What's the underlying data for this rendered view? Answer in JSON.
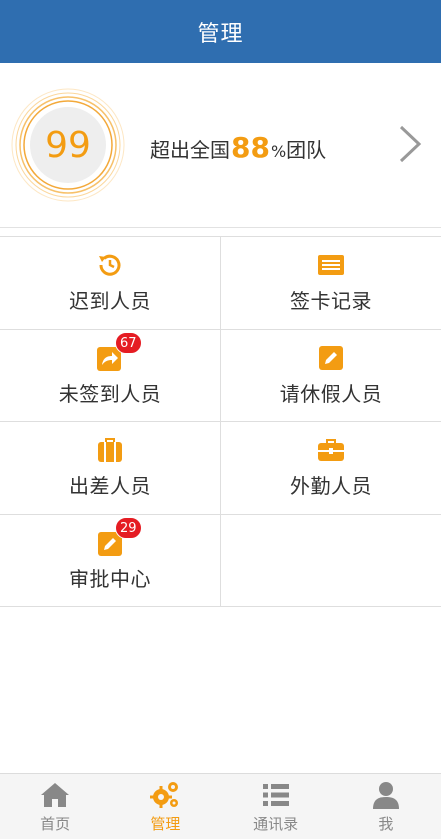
{
  "header": {
    "title": "管理"
  },
  "score": {
    "value": "99",
    "summary_prefix": "超出全国",
    "summary_percent": "88",
    "summary_percent_sign": "%",
    "summary_suffix": "团队"
  },
  "menu": [
    {
      "label": "迟到人员",
      "icon": "late-clock-icon",
      "badge": null
    },
    {
      "label": "签卡记录",
      "icon": "record-list-icon",
      "badge": null
    },
    {
      "label": "未签到人员",
      "icon": "share-arrow-icon",
      "badge": "67"
    },
    {
      "label": "请休假人员",
      "icon": "edit-pencil-icon",
      "badge": null
    },
    {
      "label": "出差人员",
      "icon": "luggage-icon",
      "badge": null
    },
    {
      "label": "外勤人员",
      "icon": "briefcase-icon",
      "badge": null
    },
    {
      "label": "审批中心",
      "icon": "approval-pencil-icon",
      "badge": "29"
    }
  ],
  "tabs": [
    {
      "label": "首页",
      "icon": "home-icon",
      "active": false
    },
    {
      "label": "管理",
      "icon": "gears-icon",
      "active": true
    },
    {
      "label": "通讯录",
      "icon": "contacts-list-icon",
      "active": false
    },
    {
      "label": "我",
      "icon": "user-icon",
      "active": false
    }
  ],
  "colors": {
    "header": "#2f6eb0",
    "accent": "#f39c12",
    "badge": "#e51c23",
    "tab_inactive": "#888888"
  }
}
